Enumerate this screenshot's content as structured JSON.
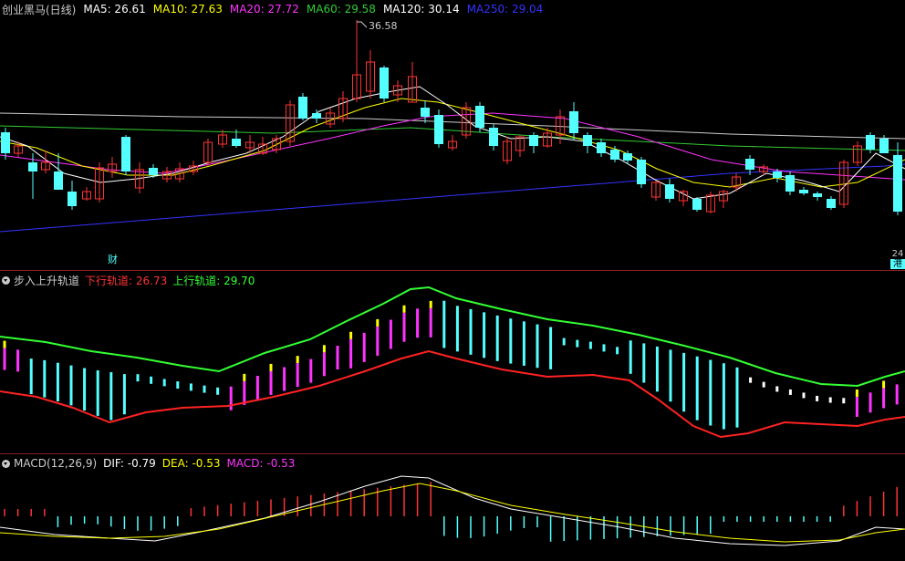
{
  "main": {
    "title": "创业黑马(日线)",
    "ma": [
      {
        "label": "MA5: 26.61",
        "color": "#ffffff"
      },
      {
        "label": "MA10: 27.63",
        "color": "#ffff00"
      },
      {
        "label": "MA20: 27.72",
        "color": "#ff33ff"
      },
      {
        "label": "MA60: 29.58",
        "color": "#33cc33"
      },
      {
        "label": "MA120: 30.14",
        "color": "#ffffff"
      },
      {
        "label": "MA250: 29.04",
        "color": "#3333ff"
      }
    ],
    "high_label": "36.58",
    "fin_mark": "财",
    "right_mark_top": "24",
    "right_mark_bottom": "港"
  },
  "channel": {
    "title": "步入上升轨道",
    "lower_label": "下行轨道: 26.73",
    "upper_label": "上行轨道: 29.70"
  },
  "macd": {
    "title": "MACD(12,26,9)",
    "dif_label": "DIF: -0.79",
    "dea_label": "DEA: -0.53",
    "macd_label": "MACD: -0.53"
  },
  "colors": {
    "up": "#ff3333",
    "down": "#54ffff",
    "separator": "#8a1f1f"
  }
}
